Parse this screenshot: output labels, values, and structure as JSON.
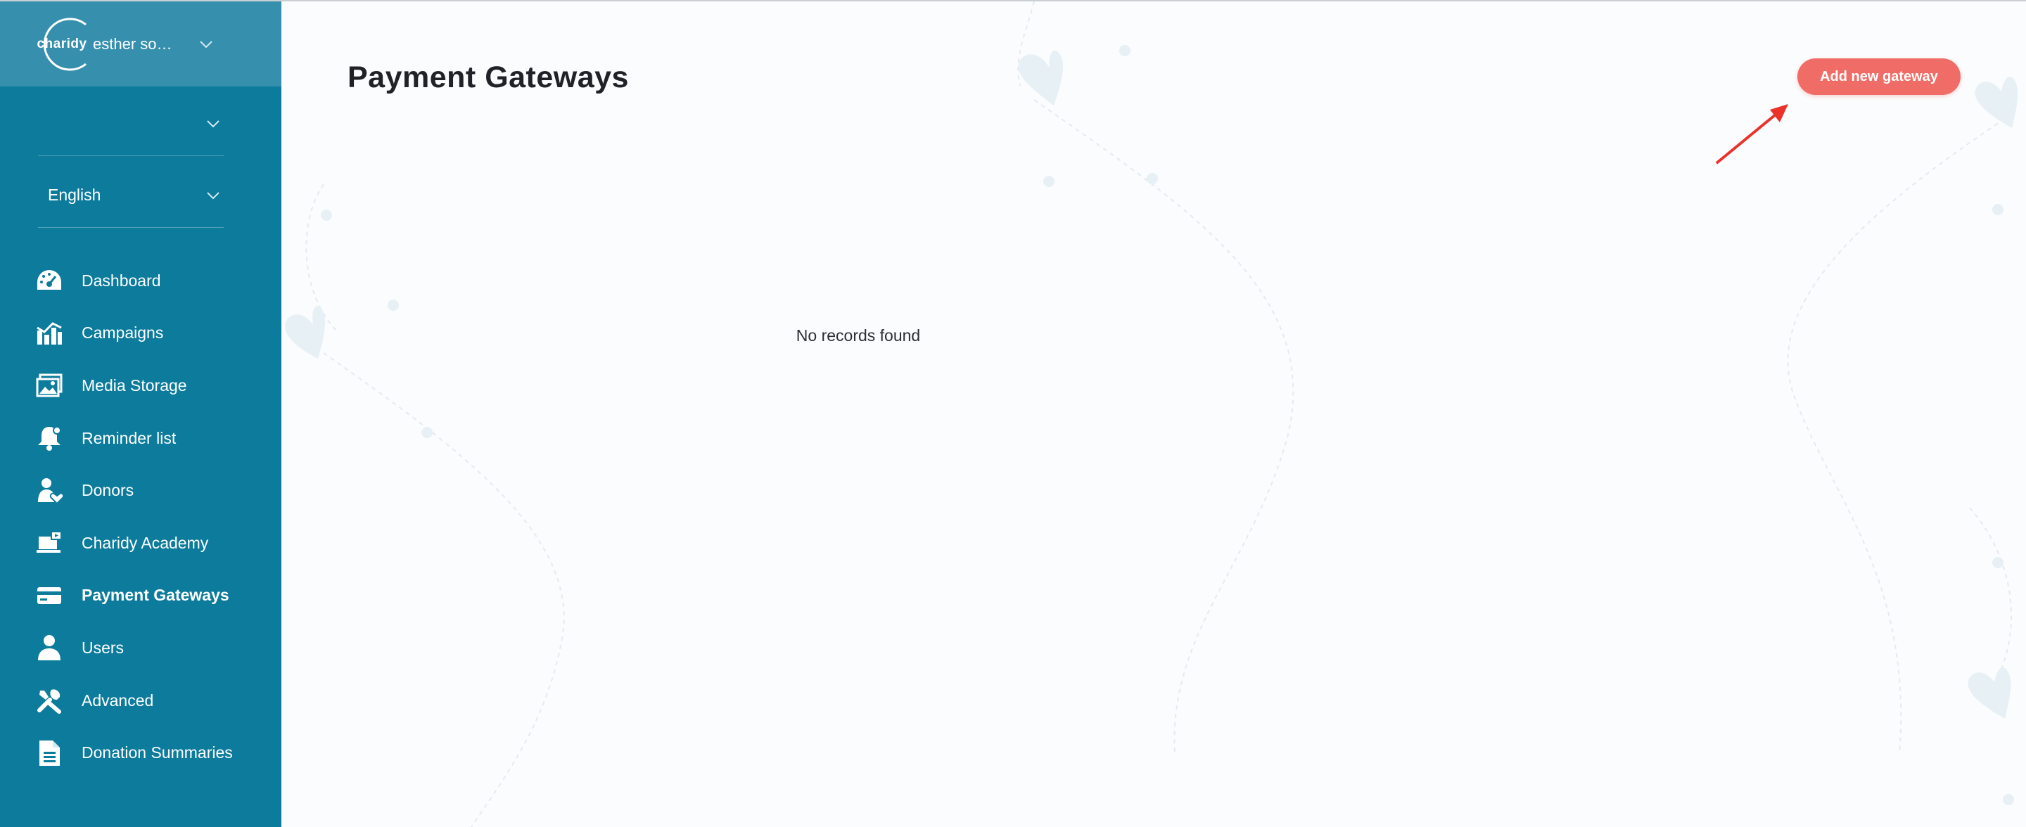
{
  "account": {
    "logo_text": "charidy",
    "name": "esther somi..."
  },
  "selectors": {
    "first_value": "",
    "language": "English"
  },
  "nav": [
    {
      "label": "Dashboard",
      "icon": "dashboard-icon"
    },
    {
      "label": "Campaigns",
      "icon": "campaigns-icon"
    },
    {
      "label": "Media Storage",
      "icon": "media-storage-icon"
    },
    {
      "label": "Reminder list",
      "icon": "bell-icon"
    },
    {
      "label": "Donors",
      "icon": "donors-icon"
    },
    {
      "label": "Charidy Academy",
      "icon": "academy-icon"
    },
    {
      "label": "Payment Gateways",
      "icon": "credit-card-icon",
      "active": true
    },
    {
      "label": "Users",
      "icon": "user-icon"
    },
    {
      "label": "Advanced",
      "icon": "tools-icon"
    },
    {
      "label": "Donation Summaries",
      "icon": "document-icon"
    }
  ],
  "main": {
    "title": "Payment Gateways",
    "add_button": "Add new gateway",
    "empty_message": "No records found"
  },
  "colors": {
    "sidebar": "#0c7b9c",
    "account_header": "#3690ad",
    "accent": "#f06c66",
    "arrow": "#e8322a"
  }
}
